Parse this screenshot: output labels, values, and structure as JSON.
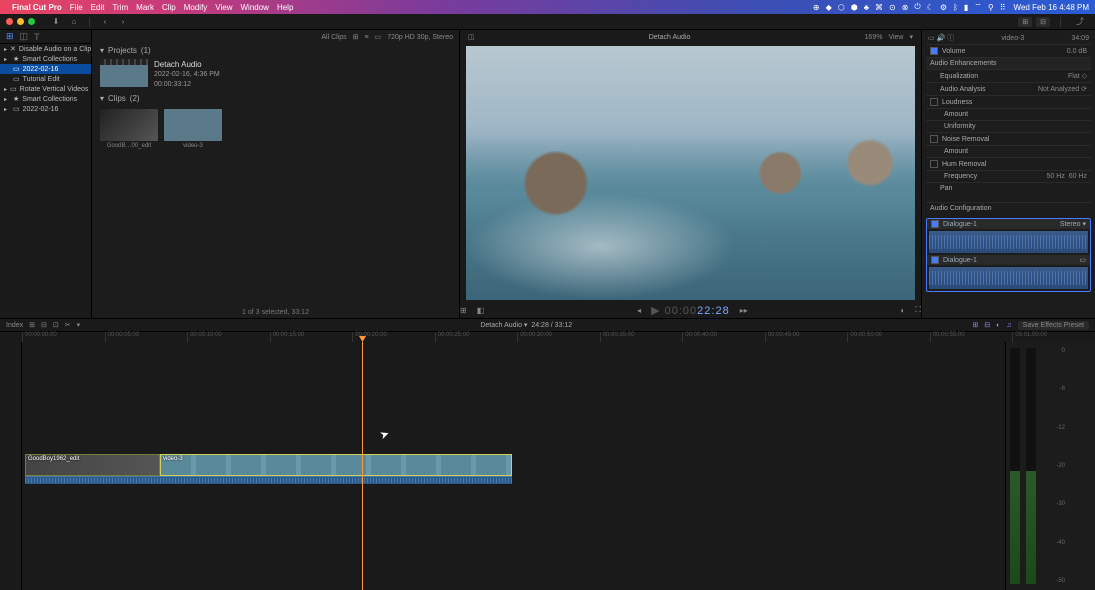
{
  "menubar": {
    "app_name": "Final Cut Pro",
    "items": [
      "File",
      "Edit",
      "Trim",
      "Mark",
      "Clip",
      "Modify",
      "View",
      "Window",
      "Help"
    ],
    "clock": "Wed Feb 16  4:48 PM"
  },
  "sidebar": {
    "items": [
      {
        "icon": "✕",
        "label": "Disable Audio on a Clip",
        "caret": "▸"
      },
      {
        "icon": "★",
        "label": "Smart Collections",
        "caret": "▸"
      },
      {
        "icon": "▭",
        "label": "2022-02-16",
        "caret": "",
        "sel": true
      },
      {
        "icon": "▭",
        "label": "Tutorial Edit",
        "caret": ""
      },
      {
        "icon": "▭",
        "label": "Rotate Vertical Videos",
        "caret": "▸"
      },
      {
        "icon": "★",
        "label": "Smart Collections",
        "caret": "▸"
      },
      {
        "icon": "▭",
        "label": "2022-02-16",
        "caret": "▸"
      }
    ]
  },
  "browser": {
    "header": {
      "filter": "All Clips",
      "format": "720p HD 30p, Stereo"
    },
    "projects_label": "Projects",
    "projects_count": "(1)",
    "project": {
      "title": "Detach Audio",
      "date": "2022-02-16, 4:36 PM",
      "dur": "00:00:33:12"
    },
    "clips_label": "Clips",
    "clips_count": "(2)",
    "clips": [
      {
        "name": "GoodB…00_edit"
      },
      {
        "name": "video-3"
      }
    ],
    "footer": "1 of 3 selected, 33:12"
  },
  "viewer": {
    "title": "Detach Audio",
    "zoom": "169%",
    "view_label": "View",
    "tc_prefix": "▶ 00:00",
    "tc": "22:28"
  },
  "inspector": {
    "clip_name": "video-3",
    "clip_dur": "34:09",
    "volume_label": "Volume",
    "volume_val": "0.0 dB",
    "section": "Audio Enhancements",
    "eq_label": "Equalization",
    "eq_val": "Flat ◇",
    "analysis_label": "Audio Analysis",
    "analysis_val": "Not Analyzed ⟳",
    "loudness_label": "Loudness",
    "amount_label": "Amount",
    "uniformity_label": "Uniformity",
    "noise_label": "Noise Removal",
    "amount2_label": "Amount",
    "hum_label": "Hum Removal",
    "freq_label": "Frequency",
    "freq_v1": "50 Hz",
    "freq_v2": "60 Hz",
    "pan_label": "Pan",
    "audio_config": "Audio Configuration",
    "dialogue1": "Dialogue-1",
    "stereo": "Stereo ▾",
    "dialogue2": "Dialogue-1"
  },
  "timeline": {
    "index_label": "Index",
    "title": "Detach Audio ▾",
    "tc": "24:28 / 33:12",
    "save_preset": "Save Effects Preset",
    "ruler": [
      "00:00:00:00",
      "00:00:05:00",
      "00:00:10:00",
      "00:00:15:00",
      "00:00:20:00",
      "00:00:25:00",
      "00:00:30:00",
      "00:00:35:00",
      "00:00:40:00",
      "00:00:45:00",
      "00:00:50:00",
      "00:00:55:00",
      "00:01:00:00"
    ],
    "clip1_label": "GoodBoy1962_edit",
    "clip2_label": "video-3",
    "meter_labels": [
      "0",
      "-6",
      "-12",
      "-20",
      "-30",
      "-40",
      "-50"
    ]
  }
}
